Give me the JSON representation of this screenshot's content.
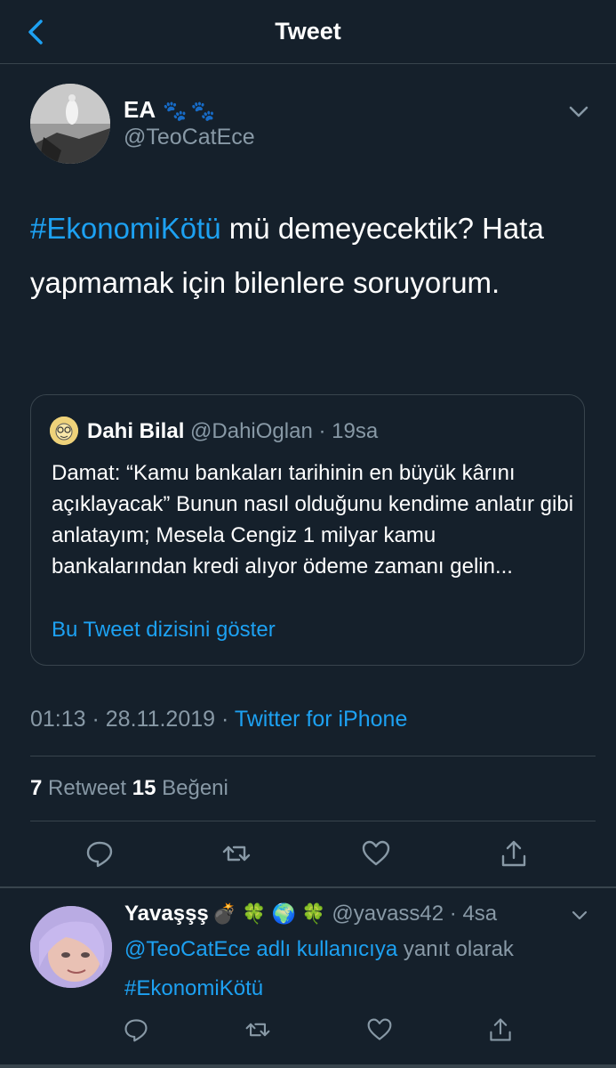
{
  "header": {
    "title": "Tweet",
    "back_icon": "chevron-left-icon"
  },
  "colors": {
    "background": "#15202b",
    "accent": "#1da1f2",
    "muted": "#8899a6",
    "border": "#38444d"
  },
  "tweet": {
    "name": "EA",
    "name_emoji": "🐾🐾",
    "handle": "@TeoCatEce",
    "hashtag": "#EkonomiKötü",
    "text_rest": " mü demeyecektik? Hata yapmamak için bilenlere soruyorum.",
    "quote": {
      "name": "Dahi Bilal",
      "handle": "@DahiOglan · 19sa",
      "text": "Damat: “Kamu bankaları tarihinin en büyük kârını açıklayacak” Bunun nasıl olduğunu kendime anlatır gibi anlatayım; Mesela Cengiz 1 milyar kamu bankalarından kredi alıyor ödeme zamanı gelin...",
      "thread_link": "Bu Tweet dizisini göster"
    },
    "time": "01:13 · 28.11.2019 · ",
    "source": "Twitter for iPhone",
    "retweet_count": "7",
    "retweet_label": " Retweet  ",
    "like_count": "15",
    "like_label": " Beğeni"
  },
  "reply": {
    "name": "Yavaşşş",
    "emojis": "💣 🍀 🌍 🍀",
    "handle": " @yavass42 · 4sa",
    "mention": "@TeoCatEce adlı kullanıcıya",
    "reply_suffix": " yanıt olarak",
    "hashtag": "#EkonomiKötü"
  }
}
